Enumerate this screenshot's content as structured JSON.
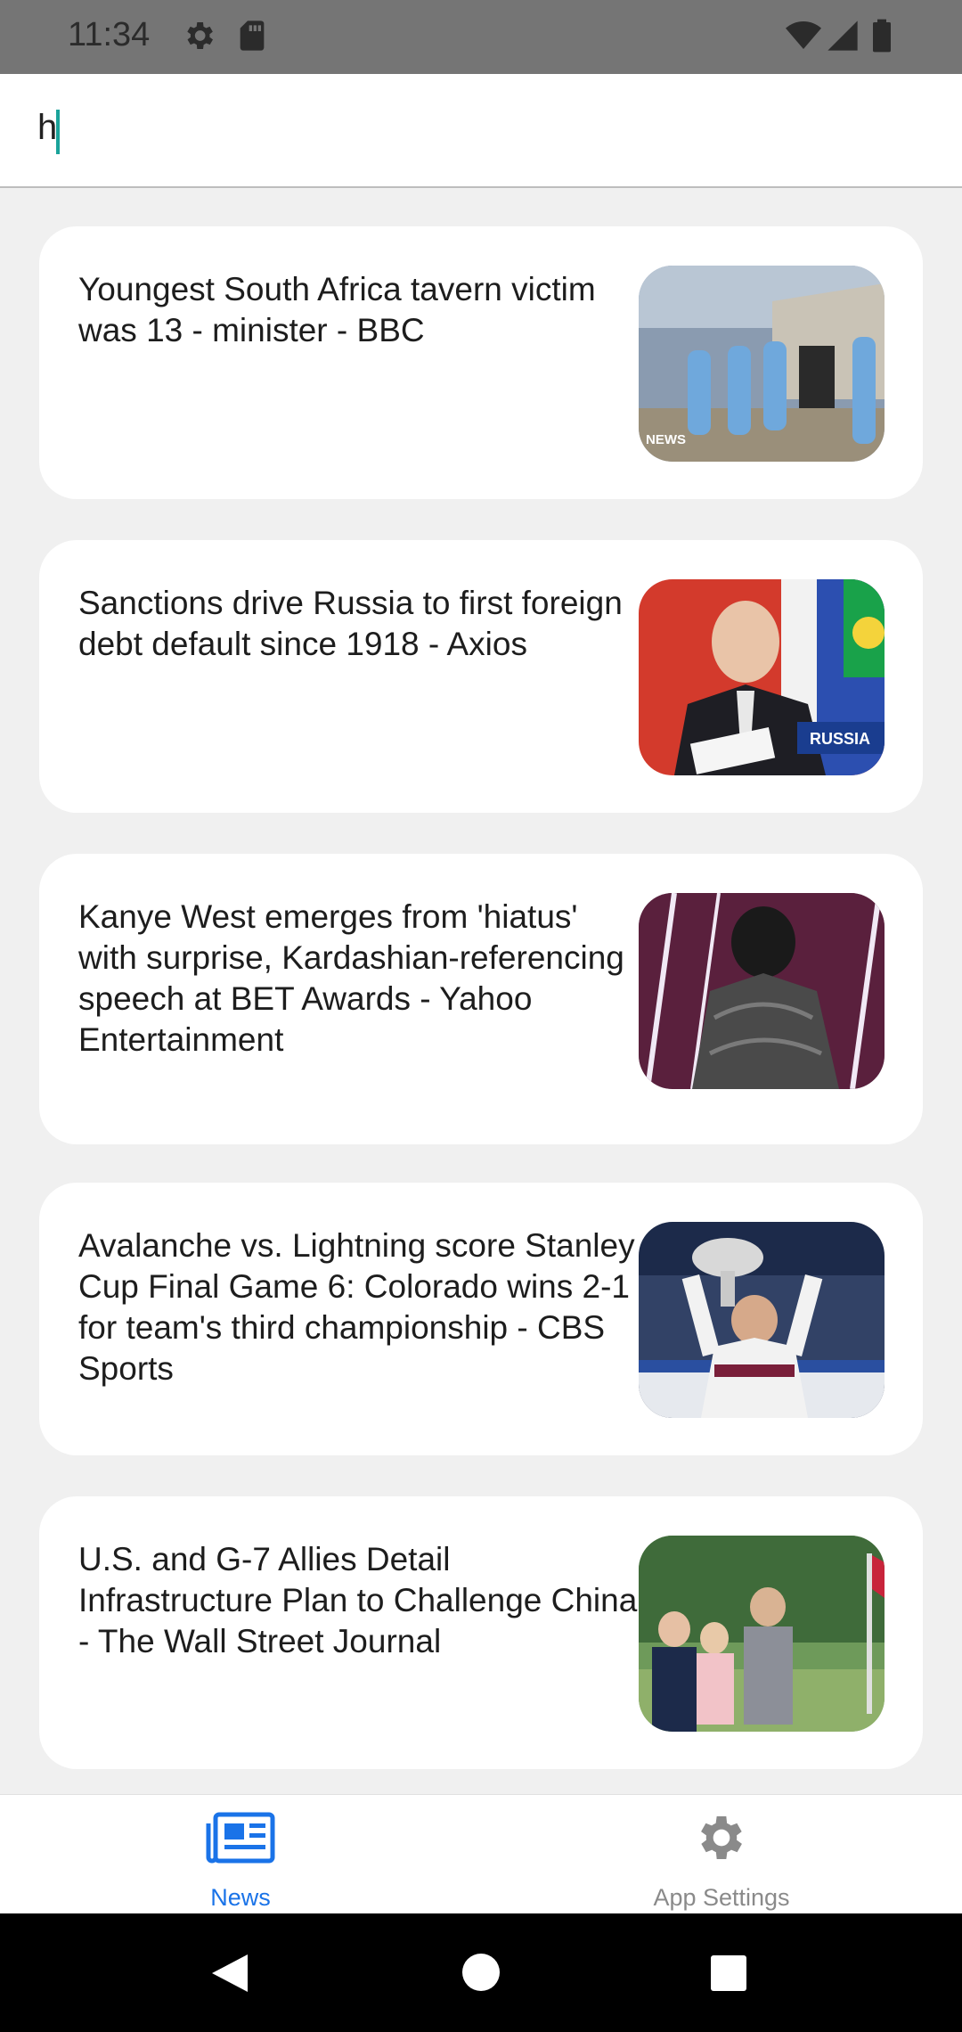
{
  "status_bar": {
    "time": "11:34"
  },
  "search": {
    "value": "h"
  },
  "articles": [
    {
      "title": "Youngest South Africa tavern victim was 13 - minister - BBC",
      "thumb_badge": "NEWS"
    },
    {
      "title": "Sanctions drive Russia to first foreign debt default since 1918 - Axios",
      "thumb_badge": "RUSSIA"
    },
    {
      "title": "Kanye West emerges from 'hiatus' with surprise, Kardashian-referencing speech at BET Awards - Yahoo Entertainment"
    },
    {
      "title": "Avalanche vs. Lightning score Stanley Cup Final Game 6: Colorado wins 2-1 for team's third championship - CBS Sports"
    },
    {
      "title": "U.S. and G-7 Allies Detail Infrastructure Plan to Challenge China - The Wall Street Journal"
    }
  ],
  "bottom_nav": {
    "items": [
      {
        "label": "News",
        "icon": "newspaper-icon",
        "active": true
      },
      {
        "label": "App Settings",
        "icon": "gear-icon",
        "active": false
      }
    ]
  },
  "colors": {
    "accent": "#1a73e8",
    "inactive": "#8a8a8a",
    "cursor": "#1aa39a"
  }
}
